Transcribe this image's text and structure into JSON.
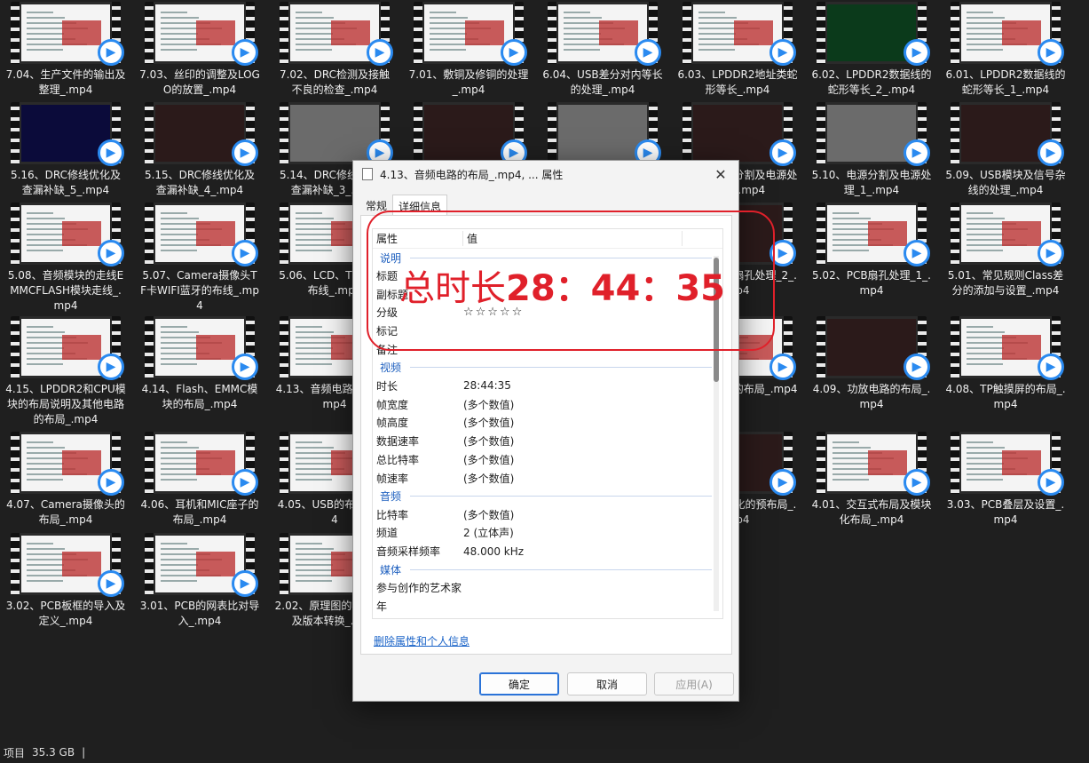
{
  "files": [
    {
      "label": "7.04、生产文件的输出及整理_.mp4",
      "frame": "doc"
    },
    {
      "label": "7.03、丝印的调整及LOGO的放置_.mp4",
      "frame": "doc"
    },
    {
      "label": "7.02、DRC检测及接触不良的检查_.mp4",
      "frame": "doc"
    },
    {
      "label": "7.01、敷铜及修铜的处理_.mp4",
      "frame": "doc"
    },
    {
      "label": "6.04、USB差分对内等长的处理_.mp4",
      "frame": "doc"
    },
    {
      "label": "6.03、LPDDR2地址类蛇形等长_.mp4",
      "frame": "doc"
    },
    {
      "label": "6.02、LPDDR2数据线的蛇形等长_2_.mp4",
      "frame": "green"
    },
    {
      "label": "6.01、LPDDR2数据线的蛇形等长_1_.mp4",
      "frame": "doc"
    },
    {
      "label": "5.16、DRC修线优化及查漏补缺_5_.mp4",
      "frame": "blue"
    },
    {
      "label": "5.15、DRC修线优化及查漏补缺_4_.mp4",
      "frame": "dark"
    },
    {
      "label": "5.14、DRC修线优化及查漏补缺_3_.mp4",
      "frame": "grey"
    },
    {
      "label": "",
      "frame": "dark"
    },
    {
      "label": "",
      "frame": "grey"
    },
    {
      "label": "5.11、电源分割及电源处理_2_.mp4",
      "frame": "dark"
    },
    {
      "label": "5.10、电源分割及电源处理_1_.mp4",
      "frame": "grey"
    },
    {
      "label": "5.09、USB模块及信号杂线的处理_.mp4",
      "frame": "dark"
    },
    {
      "label": "5.08、音频模块的走线EMMCFLASH模块走线_.mp4",
      "frame": "doc"
    },
    {
      "label": "5.07、Camera摄像头TF卡WIFI蓝牙的布线_.mp4",
      "frame": "doc"
    },
    {
      "label": "5.06、LCD、TP模块的布线_.mp4",
      "frame": "doc"
    },
    {
      "label": "",
      "frame": "doc"
    },
    {
      "label": "",
      "frame": "doc"
    },
    {
      "label": "5.03、PCB扇孔处理_2_.mp4",
      "frame": "dark"
    },
    {
      "label": "5.02、PCB扇孔处理_1_.mp4",
      "frame": "doc"
    },
    {
      "label": "5.01、常见规则Class差分的添加与设置_.mp4",
      "frame": "doc"
    },
    {
      "label": "4.15、LPDDR2和CPU模块的布局说明及其他电路的布局_.mp4",
      "frame": "doc"
    },
    {
      "label": "4.14、Flash、EMMC模块的布局_.mp4",
      "frame": "doc"
    },
    {
      "label": "4.13、音频电路的布局_.mp4",
      "frame": "doc"
    },
    {
      "label": "",
      "frame": "doc"
    },
    {
      "label": "",
      "frame": "doc"
    },
    {
      "label": "4.10、LED的布局_.mp4",
      "frame": "doc"
    },
    {
      "label": "4.09、功放电路的布局_.mp4",
      "frame": "dark"
    },
    {
      "label": "4.08、TP触摸屏的布局_.mp4",
      "frame": "doc"
    },
    {
      "label": "4.07、Camera摄像头的布局_.mp4",
      "frame": "doc"
    },
    {
      "label": "4.06、耳机和MIC座子的布局_.mp4",
      "frame": "doc"
    },
    {
      "label": "4.05、USB的布局_.mp4",
      "frame": "doc"
    },
    {
      "label": "",
      "frame": "doc"
    },
    {
      "label": "",
      "frame": "doc"
    },
    {
      "label": "4.02、模块化的预布局_.mp4",
      "frame": "dark"
    },
    {
      "label": "4.01、交互式布局及模块化布局_.mp4",
      "frame": "doc"
    },
    {
      "label": "3.03、PCB叠层及设置_.mp4",
      "frame": "doc"
    },
    {
      "label": "3.02、PCB板框的导入及定义_.mp4",
      "frame": "doc"
    },
    {
      "label": "3.01、PCB的网表比对导入_.mp4",
      "frame": "doc"
    },
    {
      "label": "2.02、原理图的检查输出及版本转换_.mp4",
      "frame": "doc"
    }
  ],
  "statusbar": {
    "items": "项目",
    "size": "35.3 GB",
    "sep": "|"
  },
  "dialog": {
    "title": "4.13、音频电路的布局_.mp4, ... 属性",
    "close": "✕",
    "tabs": [
      "常规",
      "详细信息"
    ],
    "header": {
      "col1": "属性",
      "col2": "值"
    },
    "sections": {
      "desc": "说明",
      "video": "视频",
      "audio": "音频",
      "media": "媒体"
    },
    "desc_rows": {
      "title": "标题",
      "subtitle": "副标题",
      "rating": "分级",
      "rating_value": "☆☆☆☆☆",
      "tags": "标记",
      "comments": "备注"
    },
    "video_rows": [
      {
        "k": "时长",
        "v": "28:44:35"
      },
      {
        "k": "帧宽度",
        "v": "(多个数值)"
      },
      {
        "k": "帧高度",
        "v": "(多个数值)"
      },
      {
        "k": "数据速率",
        "v": "(多个数值)"
      },
      {
        "k": "总比特率",
        "v": "(多个数值)"
      },
      {
        "k": "帧速率",
        "v": "(多个数值)"
      }
    ],
    "audio_rows": [
      {
        "k": "比特率",
        "v": "(多个数值)"
      },
      {
        "k": "频道",
        "v": "2 (立体声)"
      },
      {
        "k": "音频采样频率",
        "v": "48.000 kHz"
      }
    ],
    "media_rows": [
      {
        "k": "参与创作的艺术家",
        "v": ""
      },
      {
        "k": "年",
        "v": ""
      }
    ],
    "remove_link": "删除属性和个人信息",
    "ok": "确定",
    "cancel": "取消",
    "apply": "应用(A)"
  },
  "annotation": {
    "prefix": "总时长",
    "time": "28：44：35"
  },
  "colors": {
    "accent": "#2a8af0",
    "annotation": "#e0202a",
    "link": "#1b64c8"
  }
}
